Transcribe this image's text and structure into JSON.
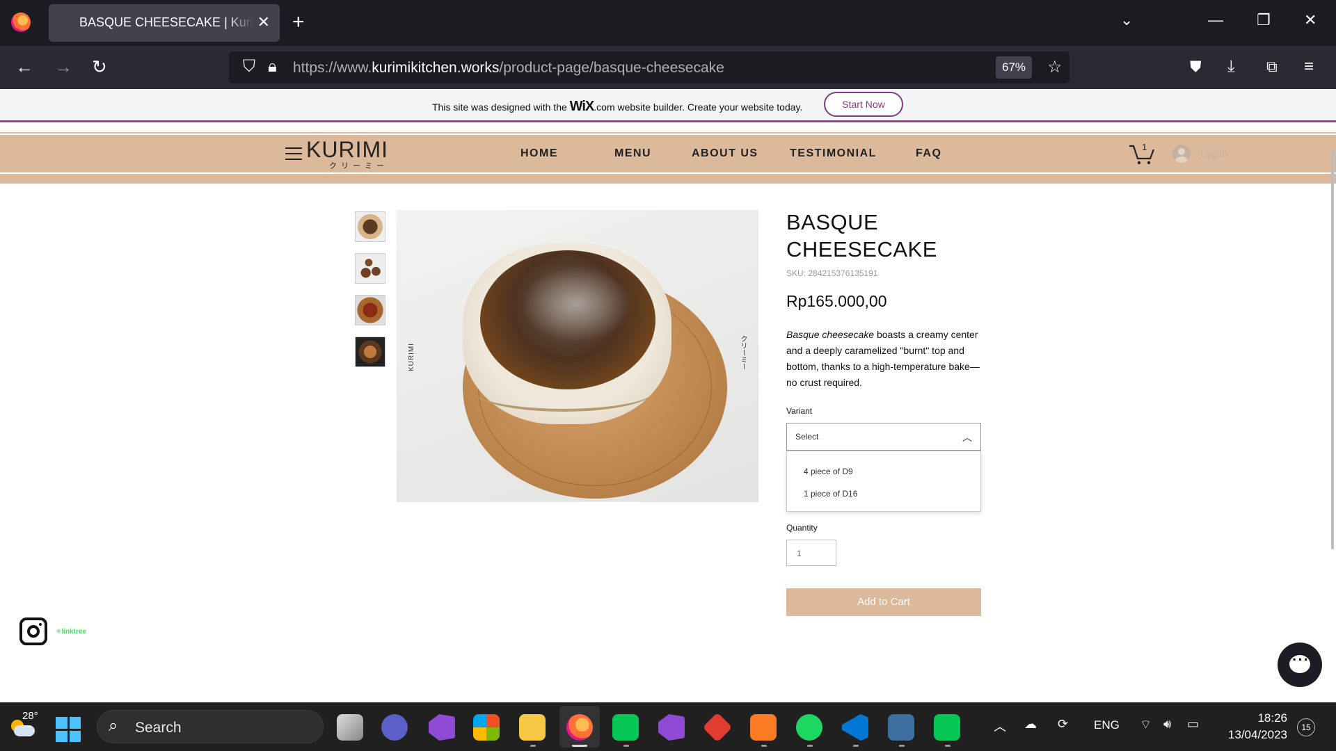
{
  "browser": {
    "tab_title": "BASQUE CHEESECAKE | Kurimi K",
    "url_prefix": "https://www.",
    "url_host": "kurimikitchen.works",
    "url_path": "/product-page/basque-cheesecake",
    "zoom": "67%"
  },
  "wix_banner": {
    "text_before": "This site was designed with the ",
    "brand": "WiX",
    "text_after": ".com website builder. Create your website today.",
    "button": "Start Now"
  },
  "site": {
    "logo": "KURIMI",
    "logo_sub": "クリーミー",
    "menu": [
      "HOME",
      "MENU",
      "ABOUT US",
      "TESTIMONIAL",
      "FAQ"
    ],
    "cart_count": "1",
    "login": "Log In"
  },
  "product": {
    "title": "BASQUE CHEESECAKE",
    "sku": "SKU: 284215376135191",
    "price": "Rp165.000,00",
    "description_italic": "Basque cheesecake",
    "description_rest": " boasts a creamy center and a deeply caramelized \"burnt\" top and bottom, thanks to a high-temperature bake—no crust required.",
    "image_text_left": "KURIMI",
    "image_text_right": "クリーミー",
    "variant_label": "Variant",
    "variant_selected": "Select",
    "variant_options": [
      "4 piece of D9",
      "1 piece of D16"
    ],
    "quantity_label": "Quantity",
    "quantity_value": "1",
    "add_to_cart": "Add to Cart"
  },
  "social": {
    "linktree": "linktree"
  },
  "taskbar": {
    "temperature": "28°",
    "search": "Search",
    "language": "ENG",
    "time": "18:26",
    "date": "13/04/2023",
    "notifications": "15"
  }
}
